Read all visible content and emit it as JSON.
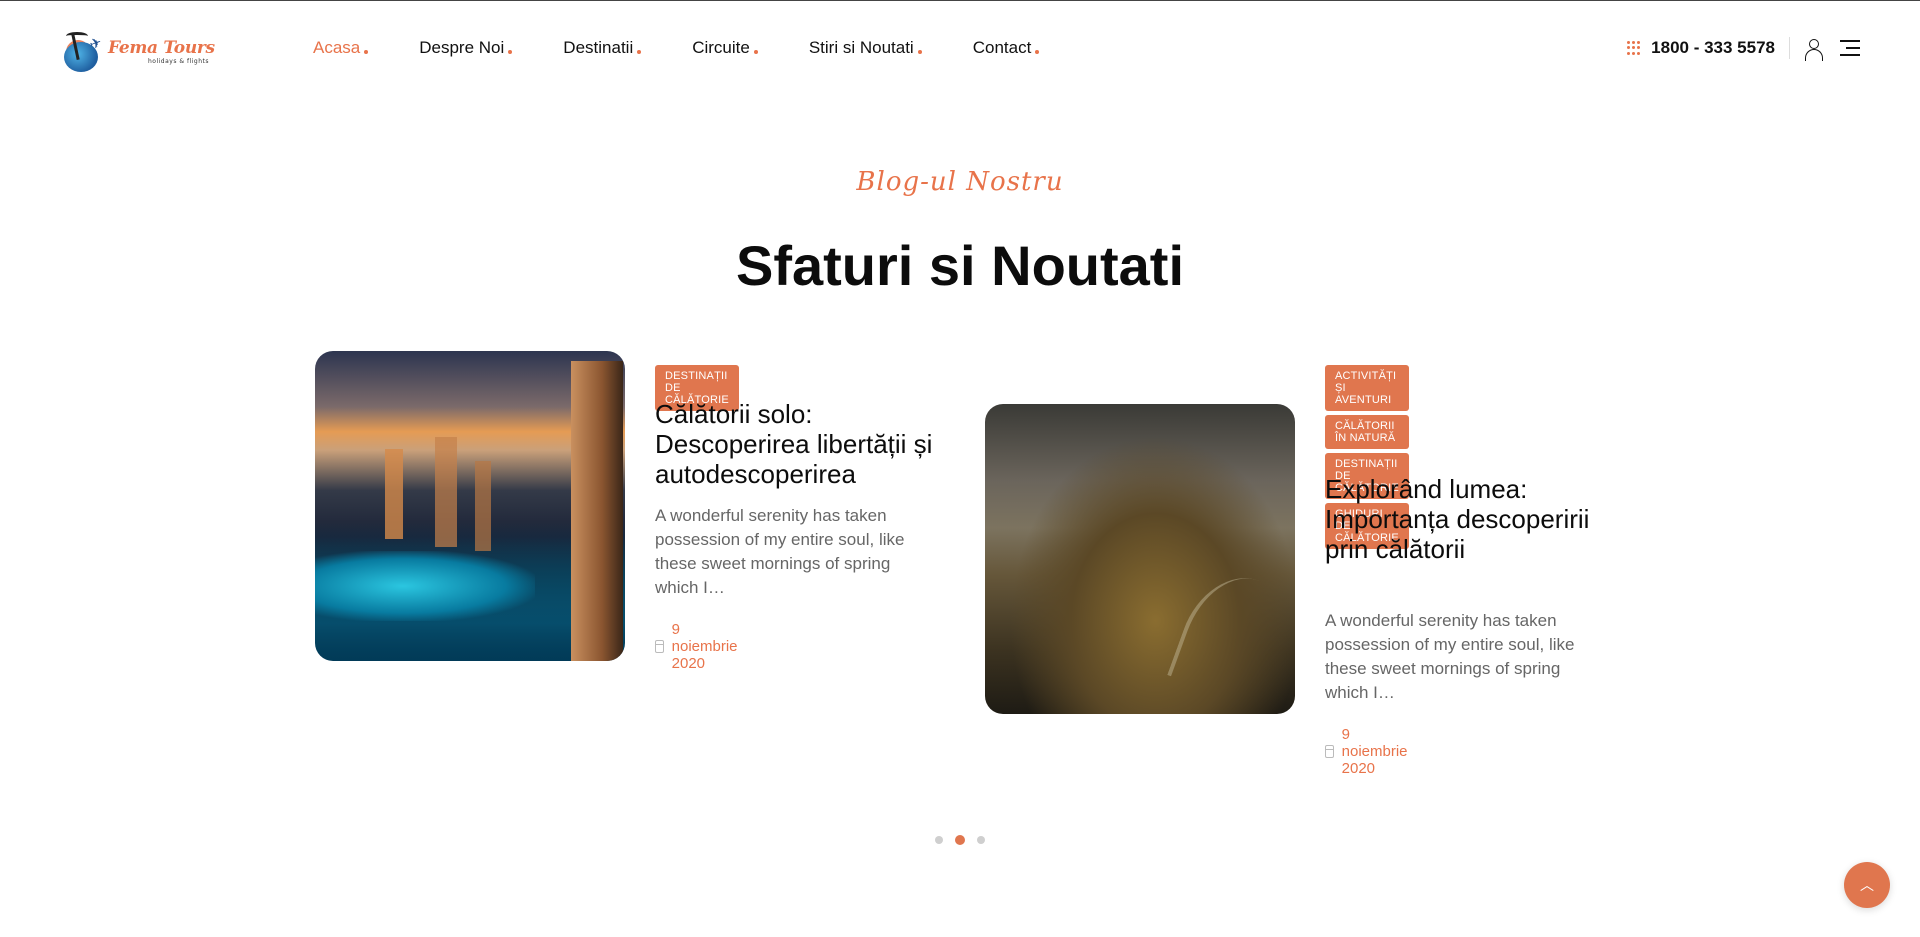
{
  "brand": {
    "name": "Fema Tours",
    "tagline": "holidays & flights"
  },
  "nav": {
    "items": [
      {
        "label": "Acasa",
        "active": true
      },
      {
        "label": "Despre Noi"
      },
      {
        "label": "Destinatii"
      },
      {
        "label": "Circuite"
      },
      {
        "label": "Stiri si Noutati"
      },
      {
        "label": "Contact"
      }
    ]
  },
  "header": {
    "phone": "1800 - 333 5578"
  },
  "section": {
    "subtitle": "Blog-ul Nostru",
    "title": "Sfaturi si Noutati"
  },
  "posts": [
    {
      "tags": [
        "DESTINAȚII DE CĂLĂTORIE"
      ],
      "title": "Călătorii solo: Descoperirea libertății și autodescoperirea",
      "excerpt": "A wonderful serenity has taken possession of my entire soul, like these sweet mornings of spring which I…",
      "date": "9 noiembrie 2020",
      "image": "city-marina"
    },
    {
      "tags": [
        "ACTIVITĂȚI ȘI AVENTURI",
        "CĂLĂTORII ÎN NATURĂ",
        "DESTINAȚII DE CĂLĂTORIE",
        "GHIDURI DE CĂLĂTORIE"
      ],
      "title": "Explorând lumea: Importanța descoperirii prin călătorii",
      "excerpt": "A wonderful serenity has taken possession of my entire soul, like these sweet mornings of spring which I…",
      "date": "9 noiembrie 2020",
      "image": "misty-hill"
    }
  ],
  "pager": {
    "count": 3,
    "active": 2
  },
  "colors": {
    "accent": "#e0764e",
    "text": "#0c0c0c",
    "muted": "#666666"
  },
  "icons": {
    "phone": "dial-grid-icon",
    "user": "user-icon",
    "menu": "menu-icon",
    "date": "calendar-icon",
    "top": "chevron-up-icon"
  }
}
